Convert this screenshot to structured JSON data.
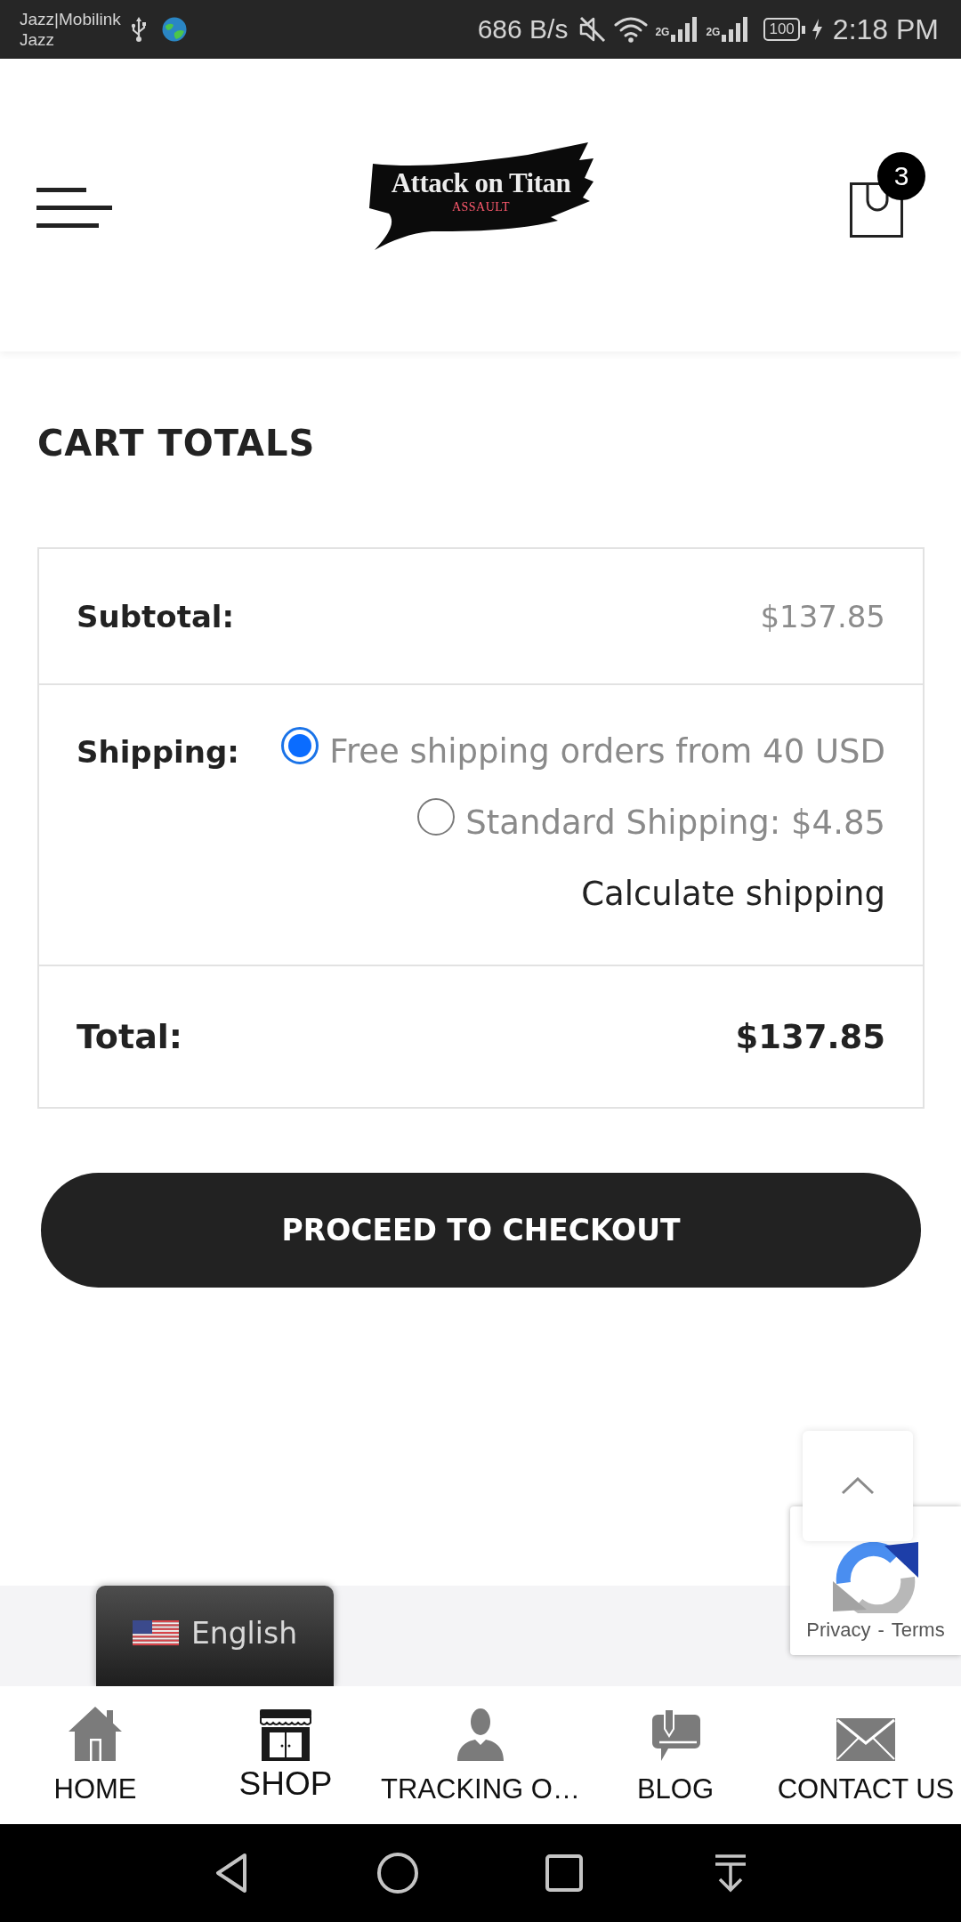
{
  "status_bar": {
    "carrier": [
      "Jazz|Mobilink",
      "Jazz"
    ],
    "speed": "686 B/s",
    "signals": [
      {
        "network": "2G"
      },
      {
        "network": "2G"
      }
    ],
    "battery": "100",
    "time": "2:18 PM"
  },
  "header": {
    "logo": {
      "title": "Attack on Titan",
      "subtitle": "ASSAULT"
    },
    "cart_count": "3"
  },
  "cart_totals": {
    "title": "CART TOTALS",
    "rows": [
      {
        "kind": "subtotal",
        "label": "Subtotal:",
        "value": "$137.85"
      },
      {
        "kind": "shipping",
        "label": "Shipping:",
        "options": [
          {
            "label": "Free shipping orders from 40 USD",
            "selected": true
          },
          {
            "label": "Standard Shipping: $4.85",
            "selected": false
          }
        ],
        "link": "Calculate shipping"
      },
      {
        "kind": "total",
        "label": "Total:",
        "value": "$137.85"
      }
    ]
  },
  "checkout_button": "PROCEED TO CHECKOUT",
  "language_switcher": {
    "label": "English"
  },
  "recaptcha": {
    "links": [
      "Privacy",
      "Terms"
    ],
    "separator": "-"
  },
  "bottom_nav": [
    {
      "label": "HOME",
      "selected": false
    },
    {
      "label": "SHOP",
      "selected": true
    },
    {
      "label": "TRACKING O…",
      "selected": false
    },
    {
      "label": "BLOG",
      "selected": false
    },
    {
      "label": "CONTACT US",
      "selected": false
    }
  ]
}
